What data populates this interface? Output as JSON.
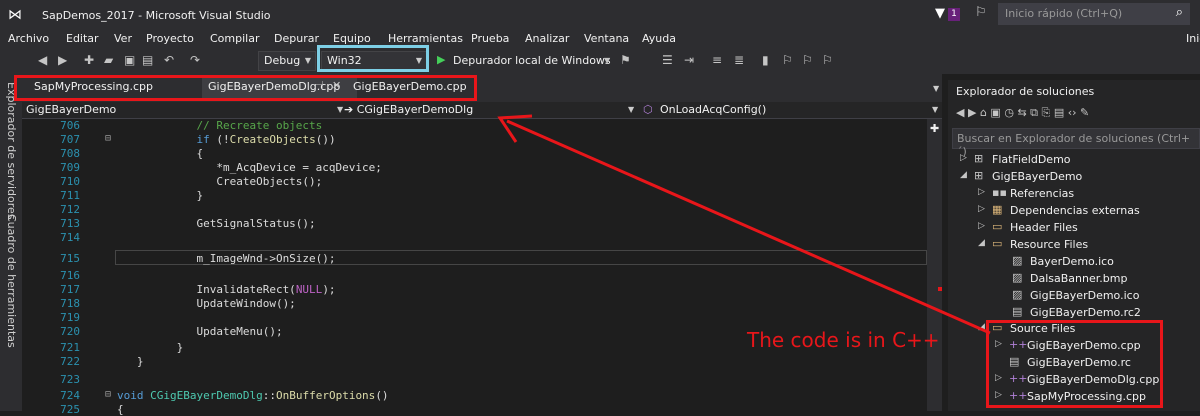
{
  "titlebar": {
    "title": "SapDemos_2017 - Microsoft Visual Studio",
    "notification_count": "1",
    "quick_launch_placeholder": "Inicio rápido (Ctrl+Q)"
  },
  "menu": [
    "Archivo",
    "Editar",
    "Ver",
    "Proyecto",
    "Compilar",
    "Depurar",
    "Equipo",
    "Herramientas",
    "Prueba",
    "Analizar",
    "Ventana",
    "Ayuda"
  ],
  "menu_right": "Inici",
  "toolbar": {
    "config": "Debug",
    "platform": "Win32",
    "debugger": "Depurador local de Windows"
  },
  "side_tools": [
    "Explorador de servidores",
    "Cuadro de herramientas"
  ],
  "tabs": [
    {
      "label": "SapMyProcessing.cpp",
      "active": false
    },
    {
      "label": "GigEBayerDemoDlg.cpp",
      "active": true
    },
    {
      "label": "GigEBayerDemo.cpp",
      "active": false
    }
  ],
  "navbar": {
    "project": "GigEBayerDemo",
    "class": "CGigEBayerDemoDlg",
    "member": "OnLoadAcqConfig()"
  },
  "code": [
    {
      "n": "706",
      "text": "            // Recreate objects"
    },
    {
      "n": "707",
      "text": "            if (!CreateObjects())"
    },
    {
      "n": "708",
      "text": "            {"
    },
    {
      "n": "709",
      "text": "               *m_AcqDevice = acqDevice;"
    },
    {
      "n": "710",
      "text": "               CreateObjects();"
    },
    {
      "n": "711",
      "text": "            }"
    },
    {
      "n": "712",
      "text": ""
    },
    {
      "n": "713",
      "text": "            GetSignalStatus();"
    },
    {
      "n": "714",
      "text": ""
    },
    {
      "n": "715",
      "text": "            m_ImageWnd->OnSize();"
    },
    {
      "n": "716",
      "text": ""
    },
    {
      "n": "717",
      "text": "            InvalidateRect(NULL);"
    },
    {
      "n": "718",
      "text": "            UpdateWindow();"
    },
    {
      "n": "719",
      "text": ""
    },
    {
      "n": "720",
      "text": "            UpdateMenu();"
    },
    {
      "n": "721",
      "text": "         }"
    },
    {
      "n": "722",
      "text": "   }"
    },
    {
      "n": "723",
      "text": ""
    },
    {
      "n": "724",
      "text": "void CGigEBayerDemoDlg::OnBufferOptions()"
    },
    {
      "n": "725",
      "text": "{"
    }
  ],
  "solution_explorer": {
    "title": "Explorador de soluciones",
    "search_placeholder": "Buscar en Explorador de soluciones (Ctrl+´)",
    "items": [
      {
        "label": "FlatFieldDemo",
        "arrow": "▷",
        "icon": "project-icon"
      },
      {
        "label": "GigEBayerDemo",
        "arrow": "◢",
        "icon": "project-icon"
      },
      {
        "label": "Referencias",
        "arrow": "▷",
        "icon": "references-icon"
      },
      {
        "label": "Dependencias externas",
        "arrow": "▷",
        "icon": "external-deps-icon"
      },
      {
        "label": "Header Files",
        "arrow": "▷",
        "icon": "folder-icon"
      },
      {
        "label": "Resource Files",
        "arrow": "◢",
        "icon": "folder-icon"
      },
      {
        "label": "BayerDemo.ico",
        "arrow": "",
        "icon": "image-file-icon"
      },
      {
        "label": "DalsaBanner.bmp",
        "arrow": "",
        "icon": "image-file-icon"
      },
      {
        "label": "GigEBayerDemo.ico",
        "arrow": "",
        "icon": "image-file-icon"
      },
      {
        "label": "GigEBayerDemo.rc2",
        "arrow": "",
        "icon": "resource-file-icon"
      },
      {
        "label": "Source Files",
        "arrow": "◢",
        "icon": "folder-icon"
      },
      {
        "label": "GigEBayerDemo.cpp",
        "arrow": "▷",
        "icon": "cpp-file-icon"
      },
      {
        "label": "GigEBayerDemo.rc",
        "arrow": "",
        "icon": "resource-file-icon"
      },
      {
        "label": "GigEBayerDemoDlg.cpp",
        "arrow": "▷",
        "icon": "cpp-file-icon"
      },
      {
        "label": "SapMyProcessing.cpp",
        "arrow": "▷",
        "icon": "cpp-file-icon"
      }
    ]
  },
  "annotation": "The code is in C++",
  "colors": {
    "highlight_red": "#e8161a",
    "highlight_blue": "#7dcfe6",
    "editor_bg": "#1e1e1e",
    "chrome_bg": "#2d2d30"
  }
}
